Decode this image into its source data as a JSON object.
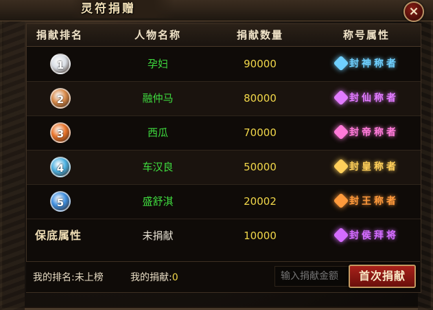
{
  "window": {
    "title": "灵符捐赠",
    "close_label": "×"
  },
  "table": {
    "headers": [
      "捐献排名",
      "人物名称",
      "捐献数量",
      "称号属性"
    ],
    "rows": [
      {
        "rank": "1",
        "name": "孕妇",
        "amount": "90000",
        "title": "封神称者",
        "medal_color": "#d8dde4",
        "title_color": "#6fd0ff"
      },
      {
        "rank": "2",
        "name": "融仲马",
        "amount": "80000",
        "title": "封仙称者",
        "medal_color": "#d88a4a",
        "title_color": "#e27bff"
      },
      {
        "rank": "3",
        "name": "西瓜",
        "amount": "70000",
        "title": "封帝称者",
        "medal_color": "#e8732a",
        "title_color": "#ff7ad9"
      },
      {
        "rank": "4",
        "name": "车汉良",
        "amount": "50000",
        "title": "封皇称者",
        "medal_color": "#4cb0e0",
        "title_color": "#ffcf5a"
      },
      {
        "rank": "5",
        "name": "盛舒淇",
        "amount": "20002",
        "title": "封王称者",
        "medal_color": "#3f8fe0",
        "title_color": "#ff9a3c"
      }
    ],
    "floor": {
      "label": "保底属性",
      "name": "未捐献",
      "amount": "10000",
      "title": "封侯拜将",
      "title_color": "#d46cff"
    }
  },
  "footer": {
    "my_rank_label": "我的排名:",
    "my_rank_value": "未上榜",
    "my_donation_label": "我的捐献:",
    "my_donation_value": "0",
    "input_placeholder": "输入捐献金额",
    "donate_button": "首次捐献"
  }
}
